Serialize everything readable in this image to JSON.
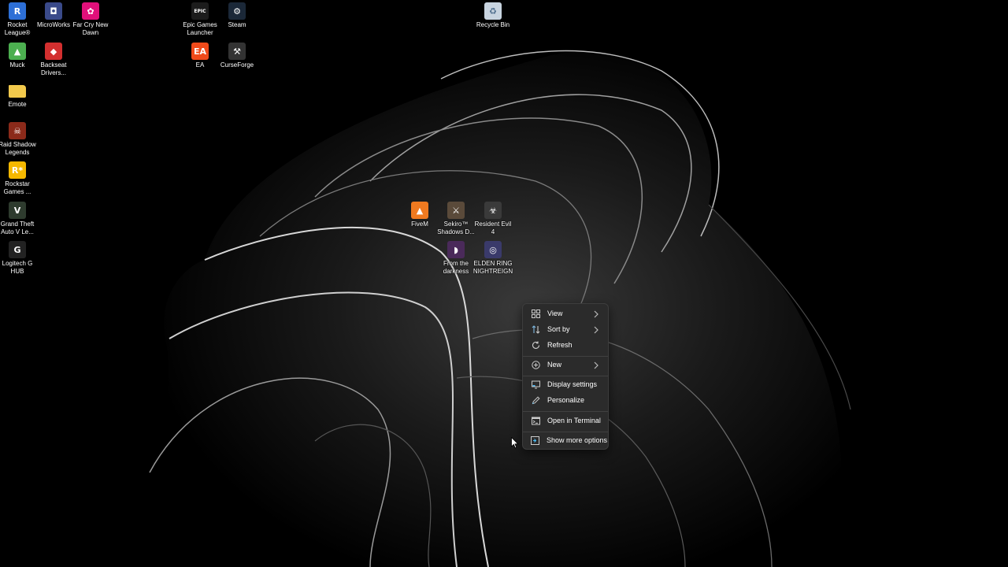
{
  "desktop": {
    "icons": [
      {
        "label": "Rocket\nLeague®",
        "icon": "rocket-league-icon",
        "color": "#2d6fd6"
      },
      {
        "label": "MicroWorks",
        "icon": "microworks-icon",
        "color": "#3a4a8a"
      },
      {
        "label": "Far Cry New\nDawn",
        "icon": "far-cry-new-dawn-icon",
        "color": "#e0107a"
      },
      {
        "label": "Epic Games\nLauncher",
        "icon": "epic-games-launcher-icon",
        "color": "#1c1c1c"
      },
      {
        "label": "Steam",
        "icon": "steam-icon",
        "color": "#1b2838"
      },
      {
        "label": "Recycle Bin",
        "icon": "recycle-bin-icon",
        "color": "#c8d4e0"
      },
      {
        "label": "Muck",
        "icon": "muck-icon",
        "color": "#4caf50"
      },
      {
        "label": "Backseat\nDrivers...",
        "icon": "backseat-drivers-icon",
        "color": "#d32f2f"
      },
      {
        "label": "EA",
        "icon": "ea-icon",
        "color": "#f04a1a"
      },
      {
        "label": "CurseForge",
        "icon": "curseforge-icon",
        "color": "#333333"
      },
      {
        "label": "Emote",
        "icon": "folder-icon",
        "color": "#f2c94c"
      },
      {
        "label": "Raid Shadow\nLegends",
        "icon": "raid-shadow-legends-icon",
        "color": "#8b2a1a"
      },
      {
        "label": "Rockstar\nGames ...",
        "icon": "rockstar-games-icon",
        "color": "#f5b800"
      },
      {
        "label": "Grand Theft\nAuto V Le...",
        "icon": "grand-theft-auto-icon",
        "color": "#2e3b2e"
      },
      {
        "label": "Logitech G\nHUB",
        "icon": "logitech-g-hub-icon",
        "color": "#222222"
      },
      {
        "label": "FiveM",
        "icon": "fivem-icon",
        "color": "#f07a20"
      },
      {
        "label": "Sekiro™\nShadows D...",
        "icon": "sekiro-icon",
        "color": "#5a4a3a"
      },
      {
        "label": "Resident Evil\n4",
        "icon": "resident-evil-4-icon",
        "color": "#3a3a3a"
      },
      {
        "label": "From the\ndarkness",
        "icon": "from-the-darkness-icon",
        "color": "#4a2a5a"
      },
      {
        "label": "ELDEN RING\nNIGHTREIGN",
        "icon": "elden-ring-nightreign-icon",
        "color": "#3a3a6a"
      }
    ]
  },
  "context_menu": {
    "view": "View",
    "sort_by": "Sort by",
    "refresh": "Refresh",
    "new": "New",
    "display_settings": "Display settings",
    "personalize": "Personalize",
    "open_in_terminal": "Open in Terminal",
    "show_more_options": "Show more options"
  },
  "colors": {
    "menu_bg": "#2b2b2b",
    "menu_text": "#ffffff",
    "accent": "#4cc2ff"
  }
}
